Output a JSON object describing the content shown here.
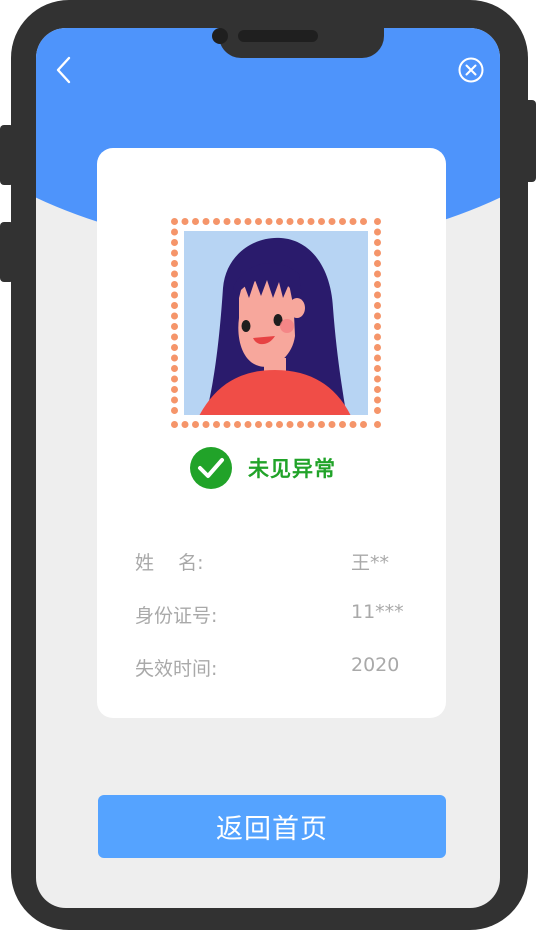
{
  "header": {
    "back_icon": "chevron-left-icon",
    "close_icon": "circle-x-icon",
    "color": "#4e94fb"
  },
  "card": {
    "photo": "avatar-girl",
    "status": {
      "icon": "check-circle-icon",
      "text": "未见异常",
      "color": "#21a329"
    },
    "info": [
      {
        "label": "姓    名:",
        "value": "王**"
      },
      {
        "label": "身份证号:",
        "value": "11***"
      },
      {
        "label": "失效时间:",
        "value": "2020"
      }
    ]
  },
  "footer": {
    "home_button_label": "返回首页",
    "color": "#55a3ff"
  }
}
